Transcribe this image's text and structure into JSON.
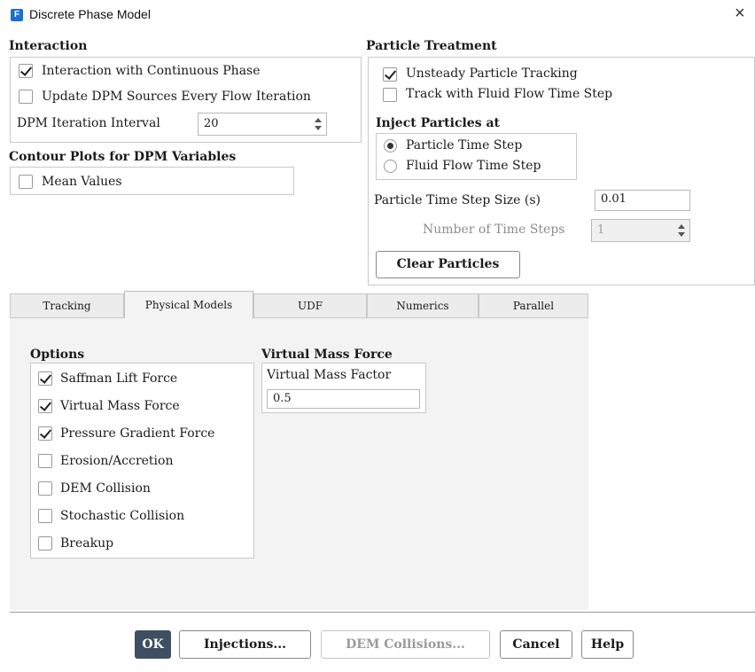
{
  "window": {
    "title": "Discrete Phase Model",
    "app_icon_letter": "F",
    "accent": "#1f6fd1"
  },
  "interaction": {
    "heading": "Interaction",
    "interaction_continuous_label": "Interaction with Continuous Phase",
    "interaction_continuous_checked": true,
    "update_sources_label": "Update DPM Sources Every Flow Iteration",
    "update_sources_checked": false,
    "iteration_interval_label": "DPM Iteration Interval",
    "iteration_interval_value": "20"
  },
  "contour": {
    "heading": "Contour Plots for DPM Variables",
    "mean_values_label": "Mean Values",
    "mean_values_checked": false
  },
  "particle_treatment": {
    "heading": "Particle Treatment",
    "unsteady_label": "Unsteady Particle Tracking",
    "unsteady_checked": true,
    "track_fluid_label": "Track with Fluid Flow Time Step",
    "track_fluid_checked": false,
    "inject_heading": "Inject Particles at",
    "inject_options": [
      "Particle Time Step",
      "Fluid Flow Time Step"
    ],
    "inject_selected": "Particle Time Step",
    "time_step_size_label": "Particle Time Step Size (s)",
    "time_step_size_value": "0.01",
    "num_time_steps_label": "Number of Time Steps",
    "num_time_steps_value": "1",
    "clear_particles_label": "Clear Particles"
  },
  "tabs": [
    "Tracking",
    "Physical Models",
    "UDF",
    "Numerics",
    "Parallel"
  ],
  "active_tab": "Physical Models",
  "options": {
    "heading": "Options",
    "items": [
      {
        "label": "Saffman Lift Force",
        "checked": true
      },
      {
        "label": "Virtual Mass Force",
        "checked": true
      },
      {
        "label": "Pressure Gradient Force",
        "checked": true
      },
      {
        "label": "Erosion/Accretion",
        "checked": false
      },
      {
        "label": "DEM Collision",
        "checked": false
      },
      {
        "label": "Stochastic Collision",
        "checked": false
      },
      {
        "label": "Breakup",
        "checked": false
      }
    ]
  },
  "virtual_mass": {
    "heading": "Virtual Mass Force",
    "factor_label": "Virtual Mass Factor",
    "factor_value": "0.5"
  },
  "footer": {
    "ok_label": "OK",
    "injections_label": "Injections...",
    "dem_collisions_label": "DEM Collisions...",
    "cancel_label": "Cancel",
    "help_label": "Help"
  }
}
